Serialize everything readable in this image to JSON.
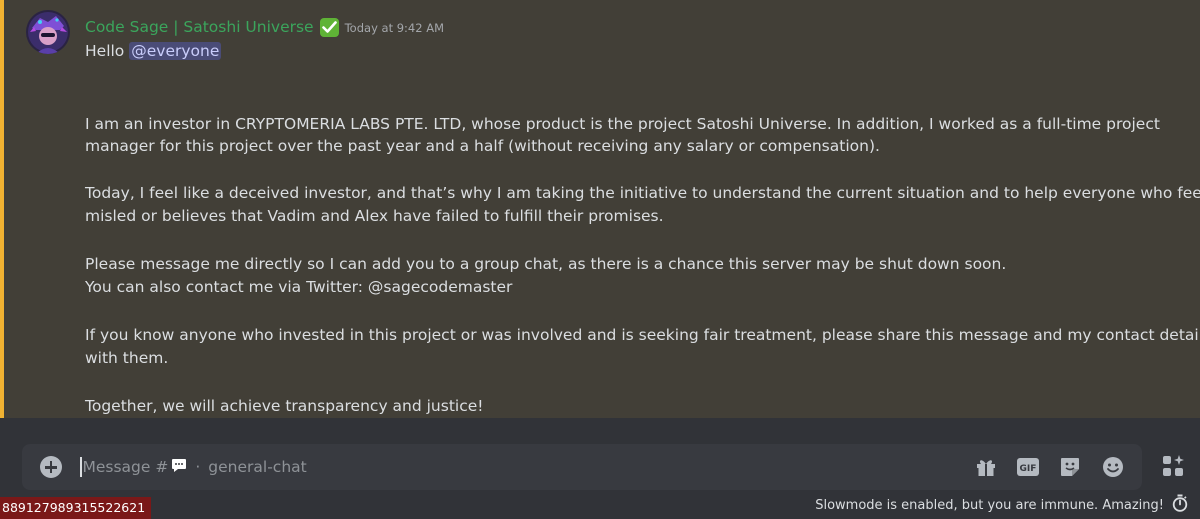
{
  "message": {
    "username": "Code Sage | Satoshi Universe",
    "timestamp": "Today at 9:42 AM",
    "greeting": "Hello",
    "mention": "@everyone",
    "paragraphs": [
      "I am an investor in CRYPTOMERIA LABS PTE. LTD, whose product is the project Satoshi Universe. In addition, I worked as a full-time project",
      "manager for this project over the past year and a half (without receiving any salary or compensation).",
      "Today, I feel like a deceived investor, and that’s why I am taking the initiative to understand the current situation and to help everyone who feels",
      "misled or believes that Vadim and Alex have failed to fulfill their promises.",
      "Please message me directly so I can add you to a group chat, as there is a chance this server may be shut down soon.",
      "You can also contact me via Twitter: @sagecodemaster",
      "If you know anyone who invested in this project or was involved and is seeking fair treatment, please share this message and my contact details",
      "with them.",
      "Together, we will achieve transparency and justice!"
    ],
    "accent_color": "#f0b232",
    "username_color": "#3ba55c"
  },
  "composer": {
    "placeholder_prefix": "Message #",
    "separator": "·",
    "channel": "general-chat",
    "tools": [
      "gift-icon",
      "gif-icon",
      "sticker-icon",
      "emoji-icon"
    ],
    "gif_label": "GIF"
  },
  "footer": {
    "id_label": "889127989315522621",
    "slowmode_text": "Slowmode is enabled, but you are immune. Amazing!"
  }
}
